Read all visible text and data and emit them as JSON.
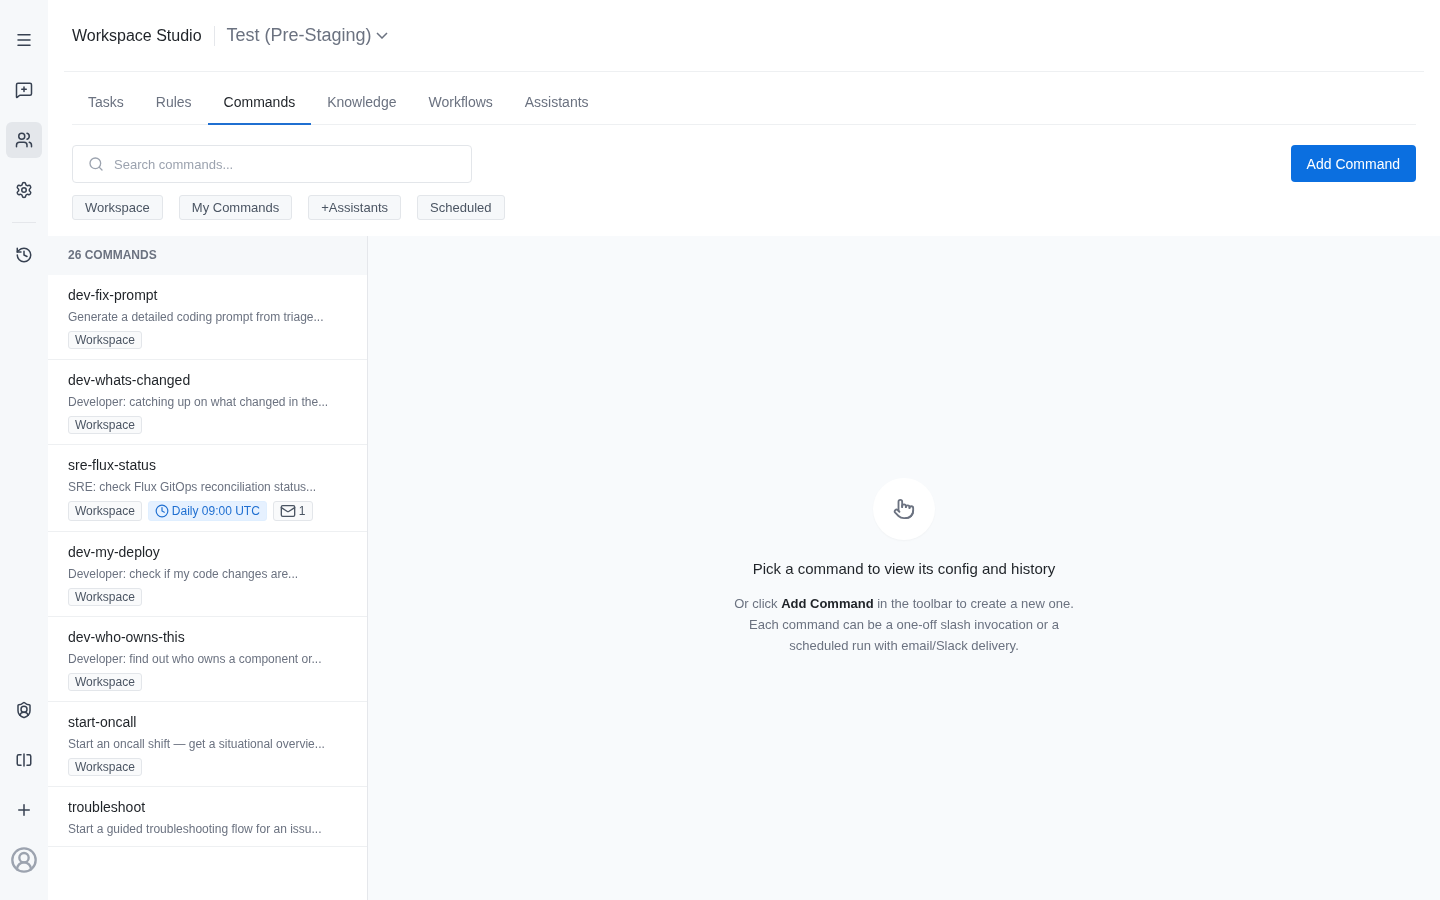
{
  "rail": {
    "top": [
      {
        "kind": "menu",
        "selected": false
      },
      {
        "kind": "compose",
        "selected": false
      },
      {
        "kind": "groups",
        "selected": true
      },
      {
        "kind": "settings",
        "selected": false
      },
      {
        "kind": "history",
        "selected": false
      }
    ],
    "bottom": [
      {
        "kind": "shield"
      },
      {
        "kind": "display"
      },
      {
        "kind": "add"
      },
      {
        "kind": "avatar"
      }
    ]
  },
  "header": {
    "title": "Workspace Studio",
    "environment": "Test (Pre-Staging)"
  },
  "tabs": [
    {
      "label": "Tasks",
      "selected": false
    },
    {
      "label": "Rules",
      "selected": false
    },
    {
      "label": "Commands",
      "selected": true
    },
    {
      "label": "Knowledge",
      "selected": false
    },
    {
      "label": "Workflows",
      "selected": false
    },
    {
      "label": "Assistants",
      "selected": false
    }
  ],
  "search": {
    "placeholder": "Search commands..."
  },
  "add_button": "Add Command",
  "filters": [
    {
      "label": "Workspace",
      "selected": false
    },
    {
      "label": "My Commands",
      "selected": false
    },
    {
      "label": "+Assistants",
      "selected": false
    },
    {
      "label": "Scheduled",
      "selected": false
    }
  ],
  "list": {
    "count": "26 COMMANDS",
    "commands": [
      {
        "name": "dev-fix-prompt",
        "description": "Generate a detailed coding prompt from triage...",
        "tags": [
          {
            "kind": "scope",
            "text": "Workspace"
          }
        ]
      },
      {
        "name": "dev-whats-changed",
        "description": "Developer: catching up on what changed in the...",
        "tags": [
          {
            "kind": "scope",
            "text": "Workspace"
          }
        ]
      },
      {
        "name": "sre-flux-status",
        "description": "SRE: check Flux GitOps reconciliation status...",
        "tags": [
          {
            "kind": "scope",
            "text": "Workspace"
          },
          {
            "kind": "schedule",
            "text": "Daily 09:00 UTC"
          },
          {
            "kind": "delivery",
            "text": "1"
          }
        ]
      },
      {
        "name": "dev-my-deploy",
        "description": "Developer: check if my code changes are...",
        "tags": [
          {
            "kind": "scope",
            "text": "Workspace"
          }
        ]
      },
      {
        "name": "dev-who-owns-this",
        "description": "Developer: find out who owns a component or...",
        "tags": [
          {
            "kind": "scope",
            "text": "Workspace"
          }
        ]
      },
      {
        "name": "start-oncall",
        "description": "Start an oncall shift — get a situational overvie...",
        "tags": [
          {
            "kind": "scope",
            "text": "Workspace"
          }
        ]
      },
      {
        "name": "troubleshoot",
        "description": "Start a guided troubleshooting flow for an issu..."
      }
    ]
  },
  "empty_state": {
    "title": "Pick a command to view its config and history",
    "text": "Or click **Add Command** in the toolbar to create a new one. Each command can be a one-off slash invocation or a scheduled run with email/Slack delivery."
  }
}
